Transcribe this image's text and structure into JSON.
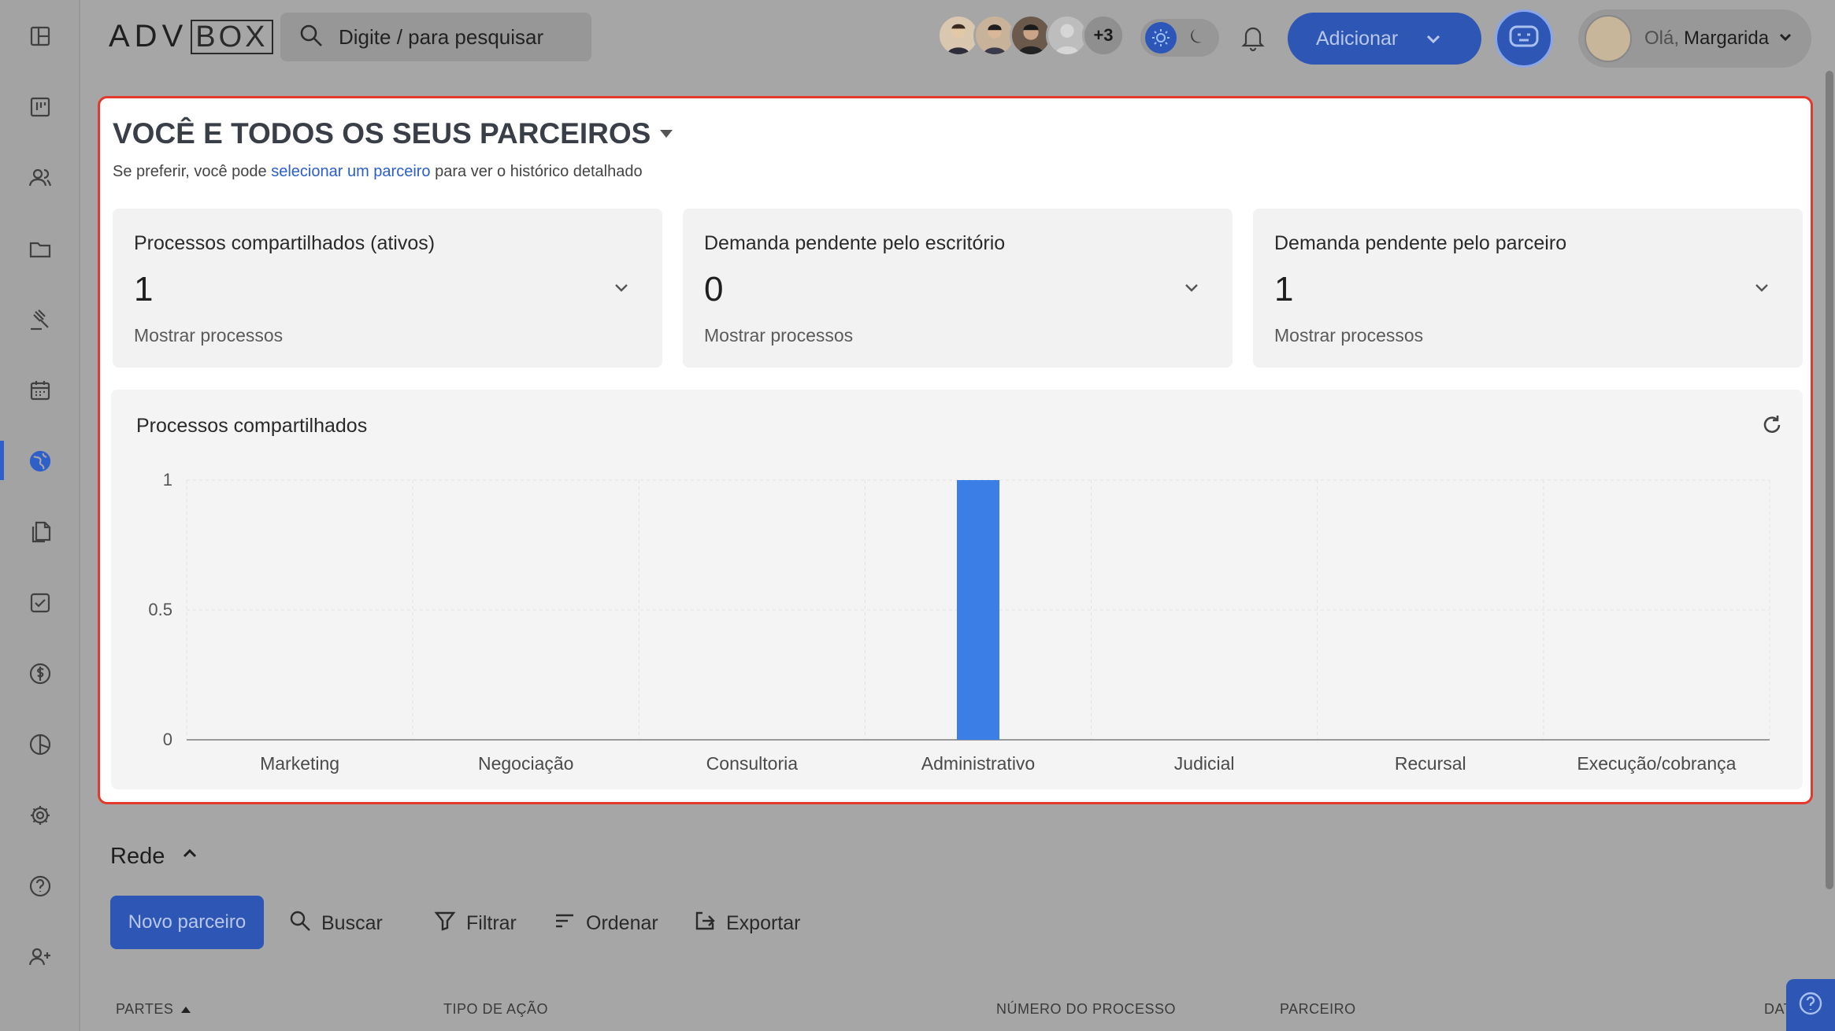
{
  "sidebar": {
    "items": [
      {
        "icon": "dashboard-icon"
      },
      {
        "icon": "kanban-icon"
      },
      {
        "icon": "people-icon"
      },
      {
        "icon": "folder-icon"
      },
      {
        "icon": "gavel-icon"
      },
      {
        "icon": "calendar-icon"
      },
      {
        "icon": "globe-icon",
        "active": true
      },
      {
        "icon": "documents-icon"
      },
      {
        "icon": "checkbox-icon"
      },
      {
        "icon": "dollar-icon"
      },
      {
        "icon": "pie-chart-icon"
      },
      {
        "icon": "gear-icon"
      },
      {
        "icon": "help-icon"
      },
      {
        "icon": "add-user-icon"
      }
    ]
  },
  "header": {
    "logo_left": "ADV",
    "logo_right": "BOX",
    "search_placeholder": "Digite / para pesquisar",
    "avatars_more": "+3",
    "add_label": "Adicionar",
    "greeting": "Olá,",
    "user_name": "Margarida"
  },
  "panel": {
    "title": "VOCÊ E TODOS OS SEUS PARCEIROS",
    "subtitle_pre": "Se preferir, você pode ",
    "subtitle_link": "selecionar um parceiro",
    "subtitle_post": " para ver o histórico detalhado",
    "cards": [
      {
        "label": "Processos compartilhados (ativos)",
        "value": "1",
        "link": "Mostrar processos"
      },
      {
        "label": "Demanda pendente pelo escritório",
        "value": "0",
        "link": "Mostrar processos"
      },
      {
        "label": "Demanda pendente pelo parceiro",
        "value": "1",
        "link": "Mostrar processos"
      }
    ]
  },
  "chart_data": {
    "type": "bar",
    "title": "Processos compartilhados",
    "categories": [
      "Marketing",
      "Negociação",
      "Consultoria",
      "Administrativo",
      "Judicial",
      "Recursal",
      "Execução/cobrança"
    ],
    "values": [
      0,
      0,
      0,
      1,
      0,
      0,
      0
    ],
    "yticks": [
      "0",
      "0.5",
      "1"
    ],
    "ylim": [
      0,
      1
    ],
    "grid": true,
    "color": "#3a7ee6"
  },
  "rede": {
    "title": "Rede",
    "new_partner": "Novo parceiro",
    "tools": {
      "search": "Buscar",
      "filter": "Filtrar",
      "sort": "Ordenar",
      "export": "Exportar"
    },
    "columns": {
      "parties": "PARTES",
      "action_type": "TIPO DE AÇÃO",
      "process_number": "NÚMERO DO PROCESSO",
      "partner": "PARCEIRO",
      "date": "DAT"
    }
  }
}
